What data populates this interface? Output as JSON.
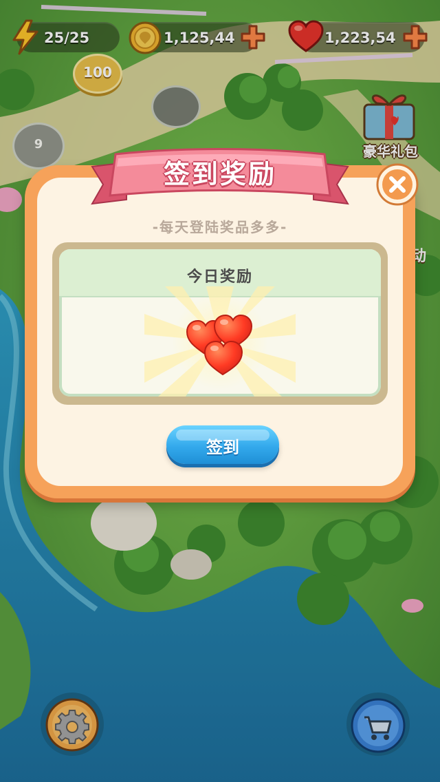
{
  "hud": {
    "energy": "25/25",
    "coins": "1,125,44",
    "hearts": "1,223,54"
  },
  "map": {
    "levels": [
      "100",
      "9"
    ]
  },
  "side_buttons": {
    "gift_pack_label": "豪华礼包",
    "cut_off_label_fragment": "动"
  },
  "modal": {
    "title": "签到奖励",
    "subtitle": "-每天登陆奖品多多-",
    "reward_header": "今日奖励",
    "sign_in_button": "签到"
  },
  "bottom_buttons": {
    "settings_icon": "gear-icon",
    "shop_icon": "shopping-cart-icon"
  },
  "colors": {
    "panel_orange": "#f6a25a",
    "panel_cream": "#fdf3e3",
    "ribbon_pink": "#f37b8e",
    "button_blue": "#33a9ec",
    "close_orange": "#f39a4e",
    "heart_red": "#ff4a2a"
  }
}
